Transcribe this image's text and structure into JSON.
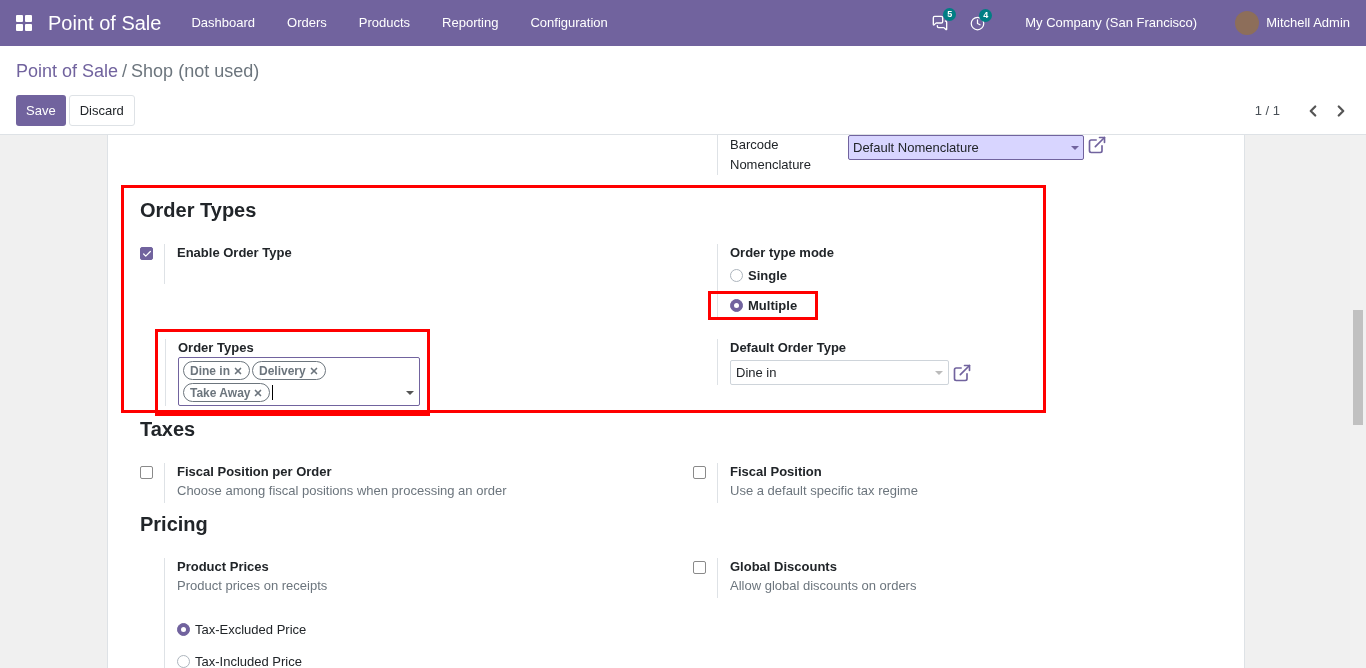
{
  "navbar": {
    "app_title": "Point of Sale",
    "menu": [
      "Dashboard",
      "Orders",
      "Products",
      "Reporting",
      "Configuration"
    ],
    "messages_badge": "5",
    "activities_badge": "4",
    "company": "My Company (San Francisco)",
    "user": "Mitchell Admin"
  },
  "breadcrumb": {
    "parent": "Point of Sale",
    "separator": "/",
    "current": "Shop (not used)"
  },
  "buttons": {
    "save": "Save",
    "discard": "Discard"
  },
  "pager": "1 / 1",
  "barcode": {
    "label": "Barcode Nomenclature",
    "value": "Default Nomenclature"
  },
  "sections": [
    {
      "title": "Order Types",
      "highlighted": true,
      "settings": [
        {
          "kind": "checkbox",
          "label": "Enable Order Type",
          "checked": true,
          "highlighted": false
        },
        {
          "kind": "radio",
          "label": "Order type mode",
          "highlighted": false,
          "options": [
            {
              "label": "Single",
              "selected": false,
              "highlighted": false
            },
            {
              "label": "Multiple",
              "selected": true,
              "highlighted": true
            }
          ]
        },
        {
          "kind": "tags",
          "label": "Order Types",
          "highlighted": true,
          "tags": [
            "Dine in",
            "Delivery",
            "Take Away"
          ]
        },
        {
          "kind": "select",
          "label": "Default Order Type",
          "value": "Dine in",
          "highlighted": false
        }
      ]
    },
    {
      "title": "Taxes",
      "highlighted": false,
      "settings": [
        {
          "kind": "checkbox",
          "label": "Fiscal Position per Order",
          "description": "Choose among fiscal positions when processing an order",
          "checked": false
        },
        {
          "kind": "checkbox",
          "label": "Fiscal Position",
          "description": "Use a default specific tax regime",
          "checked": false
        }
      ]
    },
    {
      "title": "Pricing",
      "highlighted": false,
      "settings": [
        {
          "kind": "radio",
          "label": "Product Prices",
          "description": "Product prices on receipts",
          "options": [
            {
              "label": "Tax-Excluded Price",
              "selected": true
            },
            {
              "label": "Tax-Included Price",
              "selected": false
            }
          ]
        },
        {
          "kind": "checkbox",
          "label": "Global Discounts",
          "description": "Allow global discounts on orders",
          "checked": false
        }
      ]
    }
  ]
}
